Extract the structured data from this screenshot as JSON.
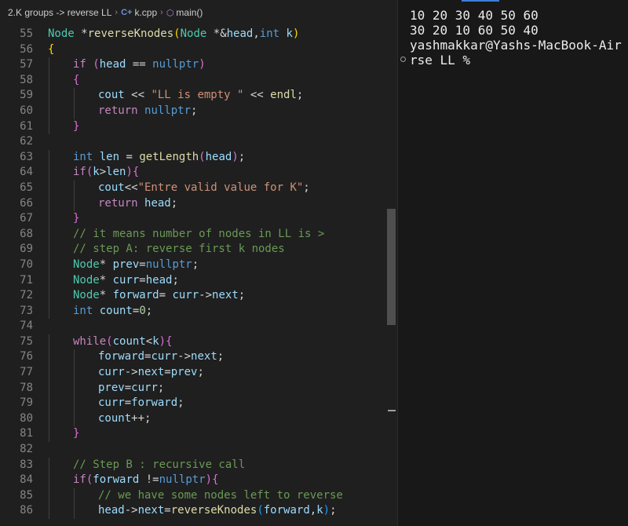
{
  "breadcrumb": {
    "folder": "2.K groups -> reverse LL",
    "file": "k.cpp",
    "symbol": "main()"
  },
  "code_lines": [
    {
      "n": "55",
      "indent": 0,
      "tokens": [
        [
          "Node ",
          "cls"
        ],
        [
          "*",
          "p"
        ],
        [
          "reverseKnodes",
          "fn"
        ],
        [
          "(",
          "br1"
        ],
        [
          "Node ",
          "cls"
        ],
        [
          "*&",
          "p"
        ],
        [
          "head",
          "var"
        ],
        [
          ",",
          "p"
        ],
        [
          "int ",
          "ty"
        ],
        [
          "k",
          "var"
        ],
        [
          ")",
          "br1"
        ]
      ]
    },
    {
      "n": "56",
      "indent": 0,
      "tokens": [
        [
          "{",
          "br1"
        ]
      ]
    },
    {
      "n": "57",
      "indent": 1,
      "tokens": [
        [
          "if ",
          "kw"
        ],
        [
          "(",
          "br2"
        ],
        [
          "head",
          "var"
        ],
        [
          " == ",
          "p"
        ],
        [
          "nullptr",
          "ty"
        ],
        [
          ")",
          "br2"
        ]
      ]
    },
    {
      "n": "58",
      "indent": 1,
      "tokens": [
        [
          "{",
          "br2"
        ]
      ]
    },
    {
      "n": "59",
      "indent": 2,
      "tokens": [
        [
          "cout",
          "var"
        ],
        [
          " << ",
          "p"
        ],
        [
          "\"LL is empty \"",
          "str"
        ],
        [
          " << ",
          "p"
        ],
        [
          "endl",
          "fn"
        ],
        [
          ";",
          "p"
        ]
      ]
    },
    {
      "n": "60",
      "indent": 2,
      "tokens": [
        [
          "return ",
          "kw"
        ],
        [
          "nullptr",
          "ty"
        ],
        [
          ";",
          "p"
        ]
      ]
    },
    {
      "n": "61",
      "indent": 1,
      "tokens": [
        [
          "}",
          "br2"
        ]
      ]
    },
    {
      "n": "62",
      "indent": 0,
      "tokens": []
    },
    {
      "n": "63",
      "indent": 1,
      "tokens": [
        [
          "int ",
          "ty"
        ],
        [
          "len",
          "var"
        ],
        [
          " = ",
          "p"
        ],
        [
          "getLength",
          "fn"
        ],
        [
          "(",
          "br2"
        ],
        [
          "head",
          "var"
        ],
        [
          ")",
          "br2"
        ],
        [
          ";",
          "p"
        ]
      ]
    },
    {
      "n": "64",
      "indent": 1,
      "tokens": [
        [
          "if",
          "kw"
        ],
        [
          "(",
          "br2"
        ],
        [
          "k",
          "var"
        ],
        [
          ">",
          "p"
        ],
        [
          "len",
          "var"
        ],
        [
          ")",
          "br2"
        ],
        [
          "{",
          "br2"
        ]
      ]
    },
    {
      "n": "65",
      "indent": 2,
      "tokens": [
        [
          "cout",
          "var"
        ],
        [
          "<<",
          "p"
        ],
        [
          "\"Entre valid value for K\"",
          "str"
        ],
        [
          ";",
          "p"
        ]
      ]
    },
    {
      "n": "66",
      "indent": 2,
      "tokens": [
        [
          "return ",
          "kw"
        ],
        [
          "head",
          "var"
        ],
        [
          ";",
          "p"
        ]
      ]
    },
    {
      "n": "67",
      "indent": 1,
      "tokens": [
        [
          "}",
          "br2"
        ]
      ]
    },
    {
      "n": "68",
      "indent": 1,
      "tokens": [
        [
          "// it means number of nodes in LL is >",
          "cm"
        ]
      ]
    },
    {
      "n": "69",
      "indent": 1,
      "tokens": [
        [
          "// step A: reverse first k nodes",
          "cm"
        ]
      ]
    },
    {
      "n": "70",
      "indent": 1,
      "tokens": [
        [
          "Node",
          "cls"
        ],
        [
          "* ",
          "p"
        ],
        [
          "prev",
          "var"
        ],
        [
          "=",
          "p"
        ],
        [
          "nullptr",
          "ty"
        ],
        [
          ";",
          "p"
        ]
      ]
    },
    {
      "n": "71",
      "indent": 1,
      "tokens": [
        [
          "Node",
          "cls"
        ],
        [
          "* ",
          "p"
        ],
        [
          "curr",
          "var"
        ],
        [
          "=",
          "p"
        ],
        [
          "head",
          "var"
        ],
        [
          ";",
          "p"
        ]
      ]
    },
    {
      "n": "72",
      "indent": 1,
      "tokens": [
        [
          "Node",
          "cls"
        ],
        [
          "* ",
          "p"
        ],
        [
          "forward",
          "var"
        ],
        [
          "= ",
          "p"
        ],
        [
          "curr",
          "var"
        ],
        [
          "->",
          "p"
        ],
        [
          "next",
          "var"
        ],
        [
          ";",
          "p"
        ]
      ]
    },
    {
      "n": "73",
      "indent": 1,
      "tokens": [
        [
          "int ",
          "ty"
        ],
        [
          "count",
          "var"
        ],
        [
          "=",
          "p"
        ],
        [
          "0",
          "num"
        ],
        [
          ";",
          "p"
        ]
      ]
    },
    {
      "n": "74",
      "indent": 0,
      "tokens": []
    },
    {
      "n": "75",
      "indent": 1,
      "tokens": [
        [
          "while",
          "kw"
        ],
        [
          "(",
          "br2"
        ],
        [
          "count",
          "var"
        ],
        [
          "<",
          "p"
        ],
        [
          "k",
          "var"
        ],
        [
          ")",
          "br2"
        ],
        [
          "{",
          "br2"
        ]
      ]
    },
    {
      "n": "76",
      "indent": 2,
      "tokens": [
        [
          "forward",
          "var"
        ],
        [
          "=",
          "p"
        ],
        [
          "curr",
          "var"
        ],
        [
          "->",
          "p"
        ],
        [
          "next",
          "var"
        ],
        [
          ";",
          "p"
        ]
      ]
    },
    {
      "n": "77",
      "indent": 2,
      "tokens": [
        [
          "curr",
          "var"
        ],
        [
          "->",
          "p"
        ],
        [
          "next",
          "var"
        ],
        [
          "=",
          "p"
        ],
        [
          "prev",
          "var"
        ],
        [
          ";",
          "p"
        ]
      ]
    },
    {
      "n": "78",
      "indent": 2,
      "tokens": [
        [
          "prev",
          "var"
        ],
        [
          "=",
          "p"
        ],
        [
          "curr",
          "var"
        ],
        [
          ";",
          "p"
        ]
      ]
    },
    {
      "n": "79",
      "indent": 2,
      "tokens": [
        [
          "curr",
          "var"
        ],
        [
          "=",
          "p"
        ],
        [
          "forward",
          "var"
        ],
        [
          ";",
          "p"
        ]
      ]
    },
    {
      "n": "80",
      "indent": 2,
      "tokens": [
        [
          "count",
          "var"
        ],
        [
          "++;",
          "p"
        ]
      ]
    },
    {
      "n": "81",
      "indent": 1,
      "tokens": [
        [
          "}",
          "br2"
        ]
      ]
    },
    {
      "n": "82",
      "indent": 0,
      "tokens": []
    },
    {
      "n": "83",
      "indent": 1,
      "tokens": [
        [
          "// Step B : recursive call",
          "cm"
        ]
      ]
    },
    {
      "n": "84",
      "indent": 1,
      "tokens": [
        [
          "if",
          "kw"
        ],
        [
          "(",
          "br2"
        ],
        [
          "forward",
          "var"
        ],
        [
          " !=",
          "p"
        ],
        [
          "nullptr",
          "ty"
        ],
        [
          ")",
          "br2"
        ],
        [
          "{",
          "br2"
        ]
      ]
    },
    {
      "n": "85",
      "indent": 2,
      "tokens": [
        [
          "// we have some nodes left to reverse",
          "cm"
        ]
      ]
    },
    {
      "n": "86",
      "indent": 2,
      "tokens": [
        [
          "head",
          "var"
        ],
        [
          "->",
          "p"
        ],
        [
          "next",
          "var"
        ],
        [
          "=",
          "p"
        ],
        [
          "reverseKnodes",
          "fn"
        ],
        [
          "(",
          "br3"
        ],
        [
          "forward",
          "var"
        ],
        [
          ",",
          "p"
        ],
        [
          "k",
          "var"
        ],
        [
          ")",
          "br3"
        ],
        [
          ";",
          "p"
        ]
      ]
    }
  ],
  "terminal": {
    "lines": [
      "10 20 30 40 50 60",
      "30 20 10 60 50 40",
      "yashmakkar@Yashs-MacBook-Air",
      "rse LL %"
    ]
  }
}
